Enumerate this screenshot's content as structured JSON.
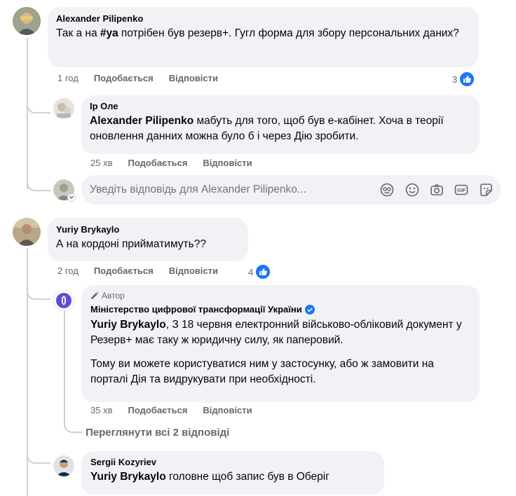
{
  "comments": [
    {
      "author": "Alexander Pilipenko",
      "text_before": "Так а на ",
      "hashtag": "#уа",
      "text_after": " потрібен був резерв+. Гугл форма для збору персональних даних?",
      "time": "1 год",
      "like_label": "Подобається",
      "reply_label": "Відповісти",
      "reaction_count": "3"
    },
    {
      "author": "Ір Оле",
      "mention": "Alexander Pilipenko",
      "text": " мабуть для того, щоб був е-кабінет. Хоча в теорії оновлення данних можна було б і через Дію зробити.",
      "time": "25 хв",
      "like_label": "Подобається",
      "reply_label": "Відповісти"
    },
    {
      "author": "Yuriy Brykaylo",
      "text": "А на кордоні прийматимуть??",
      "time": "2 год",
      "like_label": "Подобається",
      "reply_label": "Відповісти",
      "reaction_count": "4"
    },
    {
      "badge": "Автор",
      "author": "Міністерство цифрової трансформації України",
      "mention": "Yuriy Brykaylo",
      "text1": ", З 18 червня електронний військово-обліковий документ у Резерв+ має таку ж юридичну силу, як паперовий.",
      "text2": "Тому ви можете користуватися ним у застосунку, або ж замовити на порталі Дія та видрукувати при необхідності.",
      "time": "35 хв",
      "like_label": "Подобається",
      "reply_label": "Відповісти"
    },
    {
      "author": "Sergii Kozyriev",
      "mention": "Yuriy Brykaylo",
      "text": " головне щоб запис був в Оберіг"
    }
  ],
  "reply_input": {
    "placeholder": "Уведіть відповідь для Alexander Pilipenko..."
  },
  "view_replies": "Переглянути всі 2 відповіді",
  "colors": {
    "like_blue": "#1877f2",
    "verified_blue": "#1877f2",
    "bubble": "#f0f2f5",
    "meta_gray": "#65676b"
  },
  "icons": [
    "avatar-icon",
    "like-icon",
    "sticker-icon",
    "emoji-icon",
    "camera-icon",
    "gif-icon",
    "avatar-sticker-icon",
    "pen-icon",
    "verified-icon",
    "chevron-down-icon"
  ]
}
